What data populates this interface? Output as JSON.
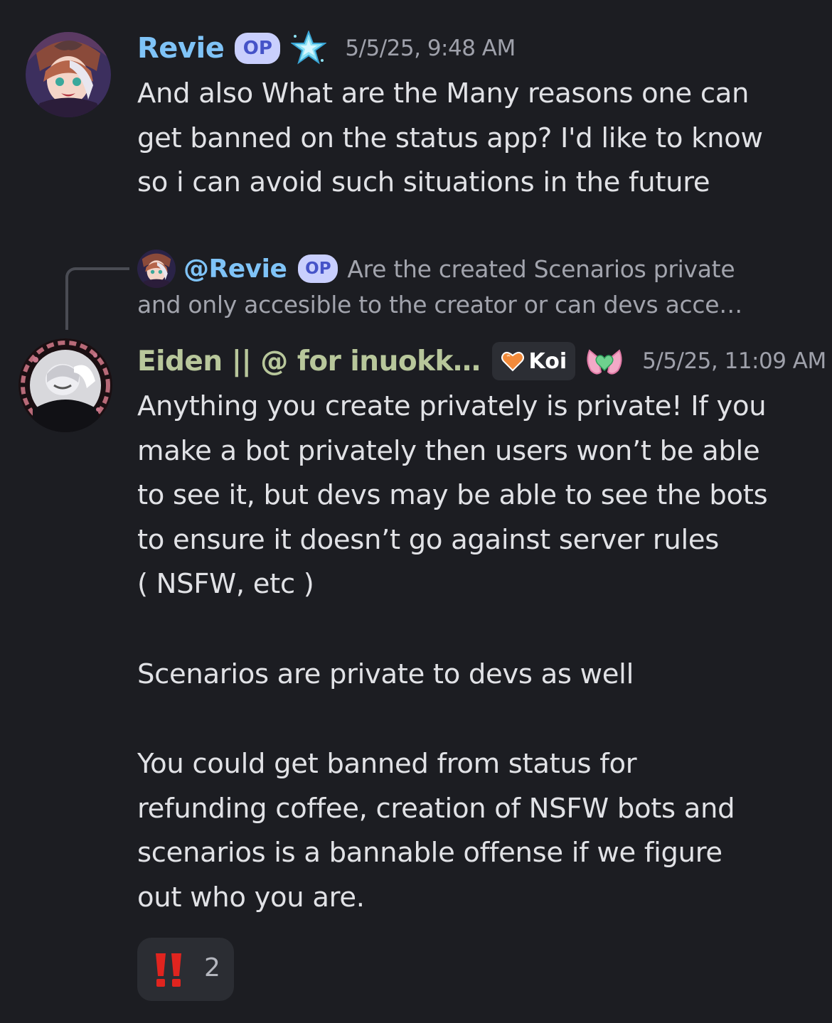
{
  "messages": [
    {
      "author": "Revie",
      "badge": "OP",
      "timestamp": "5/5/25, 9:48 AM",
      "text": "And also What are the Many reasons one can\nget banned on the status app? I'd like to know\nso i can avoid such situations in the future"
    },
    {
      "reply": {
        "mention": "@Revie",
        "badge": "OP",
        "line1": "Are the created Scenarios private",
        "line2": "and only accesible to the creator or can devs acce…"
      },
      "author": "Eiden || @ for inuokk…",
      "tag": "Koi",
      "timestamp": "5/5/25, 11:09 AM",
      "paragraphs": [
        "Anything you create privately is private! If you\nmake a bot privately then users won’t be able\nto see it, but devs may be able to see the bots\nto ensure it doesn’t go against server rules\n( NSFW, etc )",
        "Scenarios are private to devs as well",
        "You could get banned from status for\nrefunding coffee, creation of NSFW bots and\nscenarios is a bannable offense if we figure\nout who you are."
      ],
      "reaction": {
        "emoji": "‼️",
        "count": "2"
      }
    }
  ],
  "colors": {
    "background": "#1c1d22",
    "revie_name": "#7fc3f7",
    "eiden_name": "#b8c79b",
    "op_badge_bg": "#c9cffd",
    "op_badge_fg": "#4553c8",
    "timestamp": "#9fa1ab",
    "body_text": "#e1e2e6",
    "reply_text": "#a2a4ad",
    "reaction_bg": "#2b2d33",
    "exclaim_red": "#e0241f"
  }
}
